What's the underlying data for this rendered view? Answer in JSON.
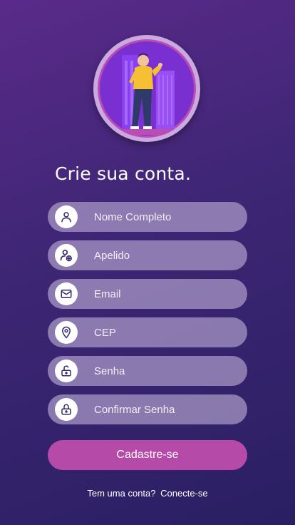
{
  "title": "Crie sua conta.",
  "avatar": {
    "icon": "illustrated-person-avatar"
  },
  "fields": [
    {
      "name": "full-name",
      "placeholder": "Nome Completo",
      "icon": "user-icon"
    },
    {
      "name": "nickname",
      "placeholder": "Apelido",
      "icon": "user-add-icon"
    },
    {
      "name": "email",
      "placeholder": "Email",
      "icon": "mail-icon"
    },
    {
      "name": "cep",
      "placeholder": "CEP",
      "icon": "location-pin-icon"
    },
    {
      "name": "password",
      "placeholder": "Senha",
      "icon": "unlock-icon"
    },
    {
      "name": "confirm-password",
      "placeholder": "Confirmar Senha",
      "icon": "lock-icon"
    }
  ],
  "submit_label": "Cadastre-se",
  "footer": {
    "prompt": "Tem uma conta?",
    "link": "Conecte-se"
  },
  "colors": {
    "background_top": "#5a2a8a",
    "background_bottom": "#2a1f63",
    "accent": "#b54aa8",
    "icon": "#3a2a6e"
  }
}
